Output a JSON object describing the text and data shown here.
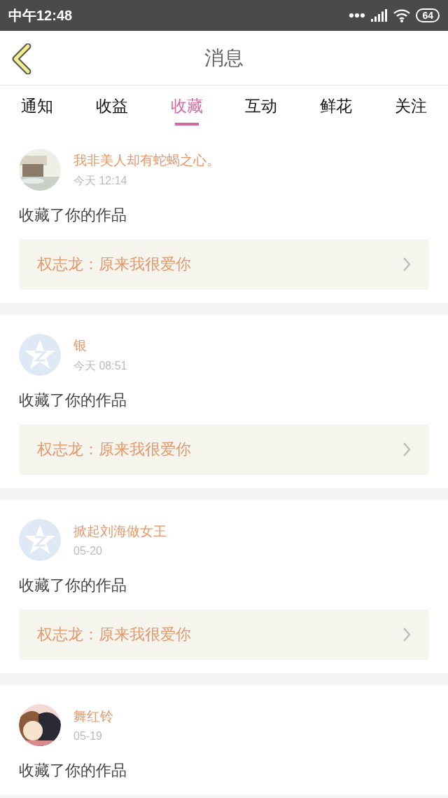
{
  "status_bar": {
    "time": "中午12:48",
    "battery": "64"
  },
  "header": {
    "title": "消息"
  },
  "tabs": [
    {
      "label": "通知",
      "selected": false
    },
    {
      "label": "收益",
      "selected": false
    },
    {
      "label": "收藏",
      "selected": true
    },
    {
      "label": "互动",
      "selected": false
    },
    {
      "label": "鲜花",
      "selected": false
    },
    {
      "label": "关注",
      "selected": false
    }
  ],
  "messages": [
    {
      "name": "我非美人却有蛇蝎之心。",
      "time": "今天 12:14",
      "text": "收藏了你的作品",
      "work": "权志龙：原来我很爱你"
    },
    {
      "avatar": {
        "kind": "default"
      },
      "name": "银",
      "time": "今天 08:51",
      "text": "收藏了你的作品",
      "work": "权志龙：原来我很爱你"
    },
    {
      "avatar": {
        "kind": "default"
      },
      "name": "掀起刘海做女王",
      "time": "05-20",
      "text": "收藏了你的作品",
      "work": "权志龙：原来我很爱你"
    },
    {
      "name": "舞红铃",
      "time": "05-19",
      "text": "收藏了你的作品"
    }
  ]
}
